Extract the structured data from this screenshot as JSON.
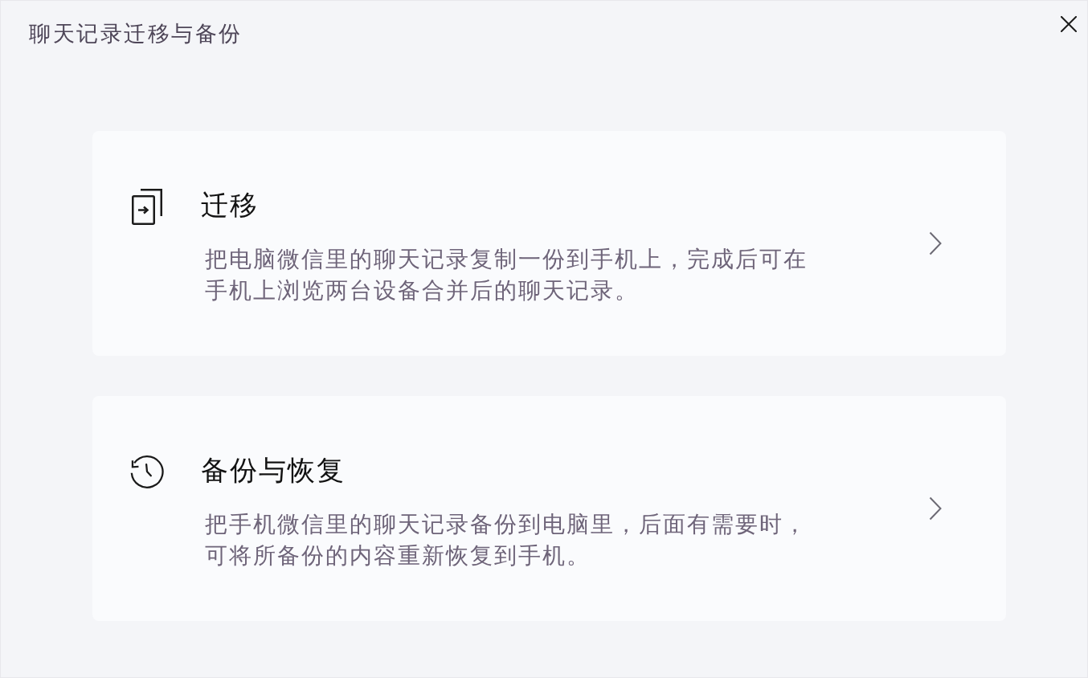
{
  "window": {
    "title": "聊天记录迁移与备份"
  },
  "options": [
    {
      "kind": "migrate",
      "title": "迁移",
      "description": "把电脑微信里的聊天记录复制一份到手机上，完成后可在手机上浏览两台设备合并后的聊天记录。"
    },
    {
      "kind": "backup",
      "title": "备份与恢复",
      "description": "把手机微信里的聊天记录备份到电脑里，后面有需要时，可将所备份的内容重新恢复到手机。"
    }
  ]
}
